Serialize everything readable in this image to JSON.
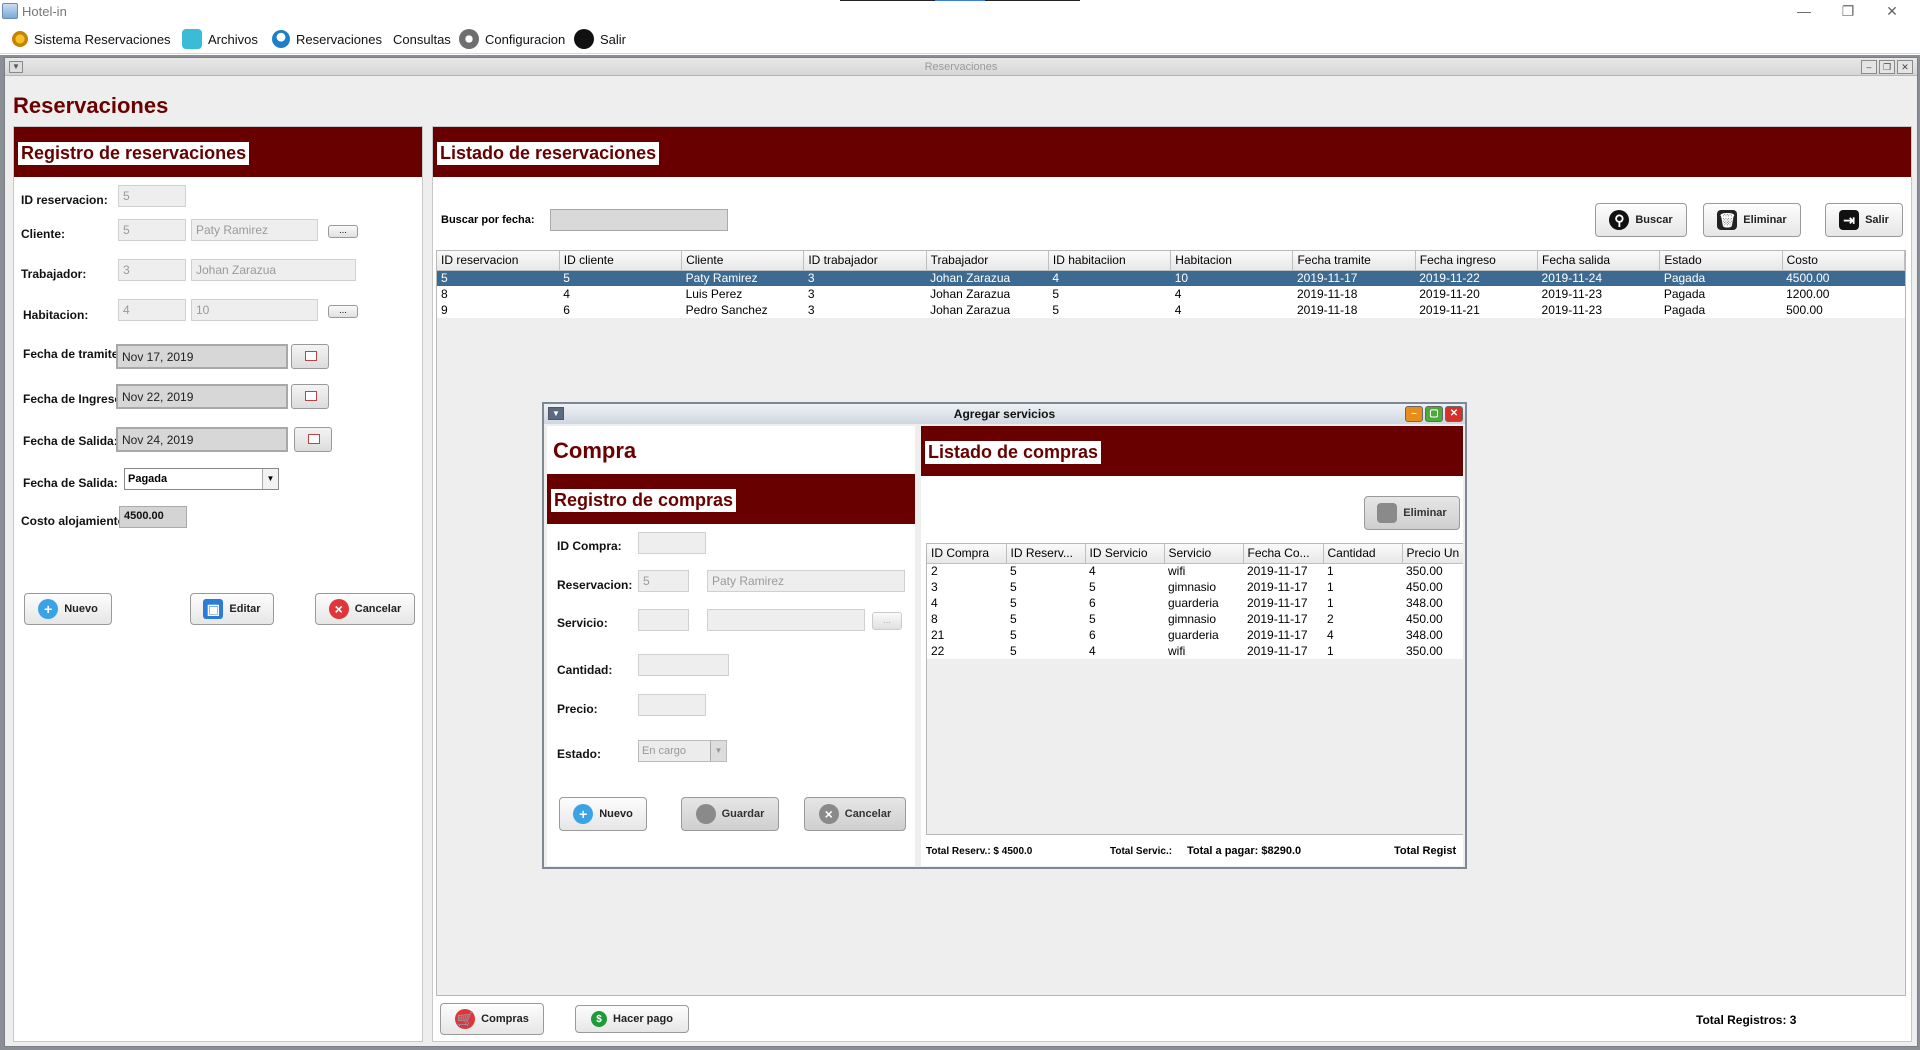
{
  "app": {
    "title": "Hotel-in",
    "minimize": "—",
    "restore": "❐",
    "close": "✕"
  },
  "menu": {
    "sistema": "Sistema Reservaciones",
    "archivos": "Archivos",
    "reservaciones": "Reservaciones",
    "consultas": "Consultas",
    "configuracion": "Configuracion",
    "salir": "Salir"
  },
  "frame": {
    "title": "Reservaciones"
  },
  "page_title": "Reservaciones",
  "registro": {
    "header": "Registro de reservaciones",
    "id_label": "ID reservacion:",
    "id_value": "5",
    "cliente_label": "Cliente:",
    "cliente_id": "5",
    "cliente_name": "Paty Ramirez",
    "trabajador_label": "Trabajador:",
    "trabajador_id": "3",
    "trabajador_name": "Johan Zarazua",
    "habitacion_label": "Habitacion:",
    "habitacion_id": "4",
    "habitacion_num": "10",
    "tramite_label": "Fecha de tramite:",
    "tramite_value": "Nov 17, 2019",
    "ingreso_label": "Fecha de Ingreso:",
    "ingreso_value": "Nov 22, 2019",
    "salida_label": "Fecha de Salida:",
    "salida_value": "Nov 24, 2019",
    "estado_label": "Fecha de Salida:",
    "estado_value": "Pagada",
    "costo_label": "Costo alojamiento:",
    "costo_value": "4500.00",
    "dots": "...",
    "nuevo": "Nuevo",
    "editar": "Editar",
    "cancelar": "Cancelar"
  },
  "listado": {
    "header": "Listado de reservaciones",
    "buscar_label": "Buscar por fecha:",
    "buscar_btn": "Buscar",
    "eliminar_btn": "Eliminar",
    "salir_btn": "Salir",
    "columns": [
      "ID reservacion",
      "ID cliente",
      "Cliente",
      "ID trabajador",
      "Trabajador",
      "ID habitaciion",
      "Habitacion",
      "Fecha tramite",
      "Fecha ingreso",
      "Fecha salida",
      "Estado",
      "Costo"
    ],
    "rows": [
      [
        "5",
        "5",
        "Paty Ramirez",
        "3",
        "Johan Zarazua",
        "4",
        "10",
        "2019-11-17",
        "2019-11-22",
        "2019-11-24",
        "Pagada",
        "4500.00"
      ],
      [
        "8",
        "4",
        "Luis Perez",
        "3",
        "Johan Zarazua",
        "5",
        "4",
        "2019-11-18",
        "2019-11-20",
        "2019-11-23",
        "Pagada",
        "1200.00"
      ],
      [
        "9",
        "6",
        "Pedro Sanchez",
        "3",
        "Johan Zarazua",
        "5",
        "4",
        "2019-11-18",
        "2019-11-21",
        "2019-11-23",
        "Pagada",
        "500.00"
      ]
    ],
    "compras_btn": "Compras",
    "pago_btn": "Hacer pago",
    "total_registros": "Total Registros: 3"
  },
  "dialog": {
    "title": "Agregar servicios",
    "compra_title": "Compra",
    "registro_header": "Registro de compras",
    "id_compra_label": "ID Compra:",
    "reservacion_label": "Reservacion:",
    "reservacion_id": "5",
    "reservacion_name": "Paty Ramirez",
    "servicio_label": "Servicio:",
    "cantidad_label": "Cantidad:",
    "precio_label": "Precio:",
    "estado_label": "Estado:",
    "estado_value": "En cargo",
    "dots": "...",
    "nuevo": "Nuevo",
    "guardar": "Guardar",
    "cancelar": "Cancelar",
    "listado_header": "Listado de compras",
    "eliminar": "Eliminar",
    "columns": [
      "ID Compra",
      "ID Reserv...",
      "ID Servicio",
      "Servicio",
      "Fecha Co...",
      "Cantidad",
      "Precio Un"
    ],
    "rows": [
      [
        "2",
        "5",
        "4",
        "wifi",
        "2019-11-17",
        "1",
        "350.00"
      ],
      [
        "3",
        "5",
        "5",
        "gimnasio",
        "2019-11-17",
        "1",
        "450.00"
      ],
      [
        "4",
        "5",
        "6",
        "guarderia",
        "2019-11-17",
        "1",
        "348.00"
      ],
      [
        "8",
        "5",
        "5",
        "gimnasio",
        "2019-11-17",
        "2",
        "450.00"
      ],
      [
        "21",
        "5",
        "6",
        "guarderia",
        "2019-11-17",
        "4",
        "348.00"
      ],
      [
        "22",
        "5",
        "4",
        "wifi",
        "2019-11-17",
        "1",
        "350.00"
      ]
    ],
    "total_reserv": "Total Reserv.: $ 4500.0",
    "total_servic": "Total Servic.:",
    "total_pagar": "Total a pagar: $8290.0",
    "total_regist": "Total Regist"
  }
}
